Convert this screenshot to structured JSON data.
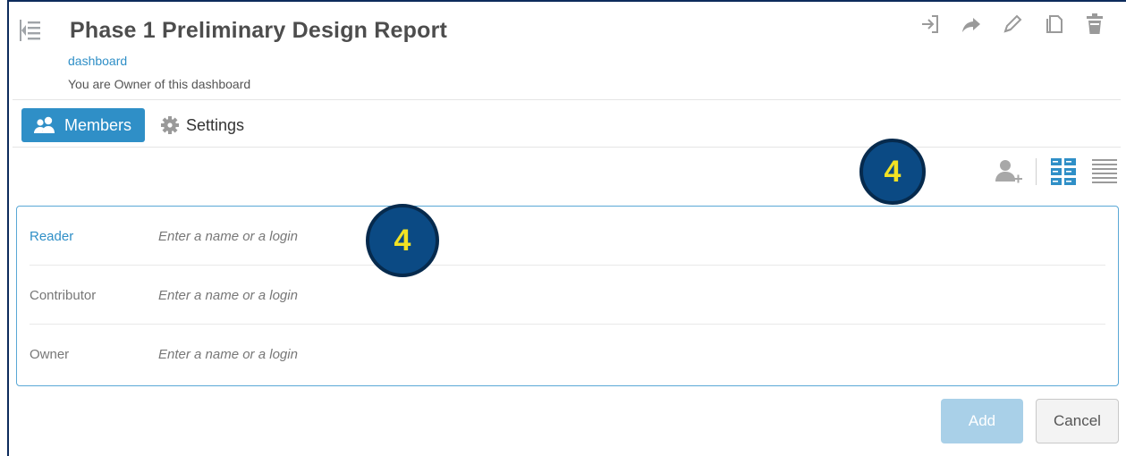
{
  "header": {
    "title": "Phase 1 Preliminary Design Report",
    "type_link": "dashboard",
    "ownership_text": "You are Owner of this dashboard",
    "actions": [
      "exit-icon",
      "share-arrow-icon",
      "pencil-icon",
      "copy-icon",
      "trash-icon"
    ]
  },
  "tabs": [
    {
      "label": "Members",
      "icon": "users-icon",
      "active": true
    },
    {
      "label": "Settings",
      "icon": "gear-icon",
      "active": false
    }
  ],
  "toolbar": {
    "icons": [
      "add-user-icon",
      "grid-view-icon",
      "list-view-icon"
    ]
  },
  "callouts": [
    "4",
    "4"
  ],
  "members_form": {
    "rows": [
      {
        "role": "Reader",
        "placeholder": "Enter a name or a login"
      },
      {
        "role": "Contributor",
        "placeholder": "Enter a name or a login"
      },
      {
        "role": "Owner",
        "placeholder": "Enter a name or a login"
      }
    ]
  },
  "buttons": {
    "add": "Add",
    "cancel": "Cancel"
  },
  "colors": {
    "accent": "#2f8fc7",
    "callout_fill": "#0b4a84",
    "callout_text": "#f2e224",
    "arrow": "#1ab3b0"
  }
}
